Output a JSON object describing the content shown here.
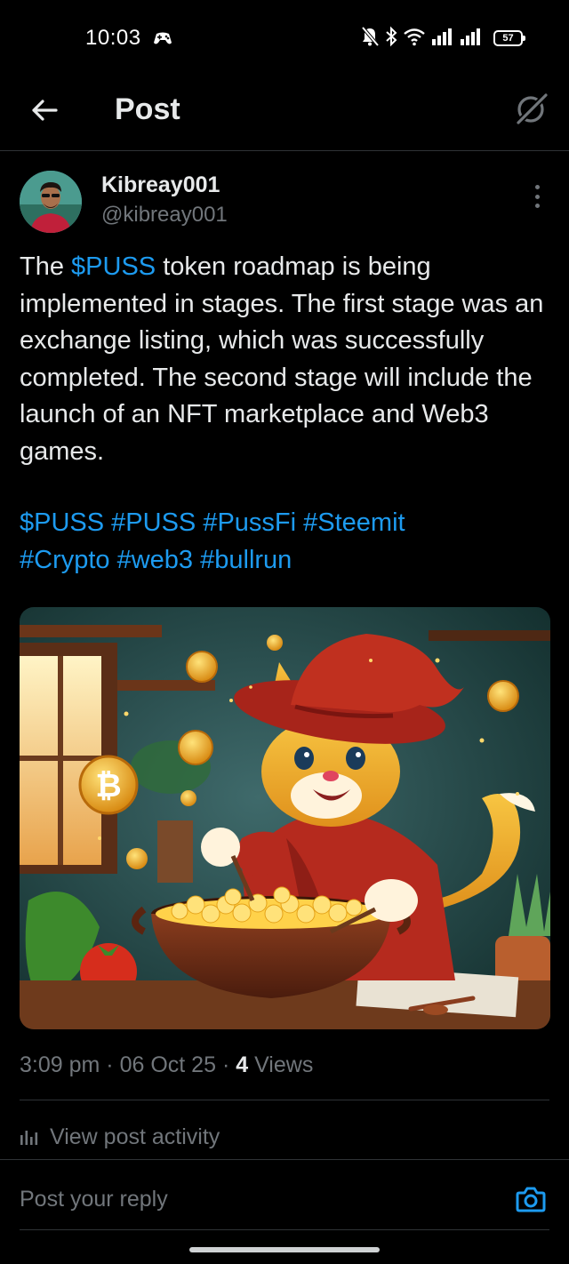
{
  "status_bar": {
    "time": "10:03",
    "battery": "57",
    "icons": [
      "game-controller-icon",
      "mute-bell-icon",
      "bluetooth-icon",
      "wifi-icon",
      "signal-icon",
      "signal-icon",
      "battery-icon"
    ]
  },
  "header": {
    "title": "Post",
    "back_icon": "back-arrow-icon",
    "grok_icon": "grok-icon"
  },
  "post": {
    "author_name": "Kibreay001",
    "author_handle": "@kibreay001",
    "text_parts": [
      "The ",
      "$PUSS",
      " token roadmap is being implemented in stages. The first stage was an exchange listing, which was successfully completed. The second stage will include the launch of an NFT marketplace and Web3 games."
    ],
    "hashtags_line1": "$PUSS #PUSS #PussFi #Steemit",
    "hashtags_line2": "#Crypto #web3 #bullrun",
    "time": "3:09 pm",
    "date": "06 Oct 25",
    "views_count": "4",
    "views_label": "Views",
    "separator": "·",
    "activity_label": "View post activity"
  },
  "reply": {
    "placeholder": "Post your reply",
    "camera_icon": "camera-icon"
  },
  "colors": {
    "background": "#000000",
    "text": "#e7e9ea",
    "muted": "#71767b",
    "accent": "#1d9bf0",
    "divider": "#2f3336"
  }
}
